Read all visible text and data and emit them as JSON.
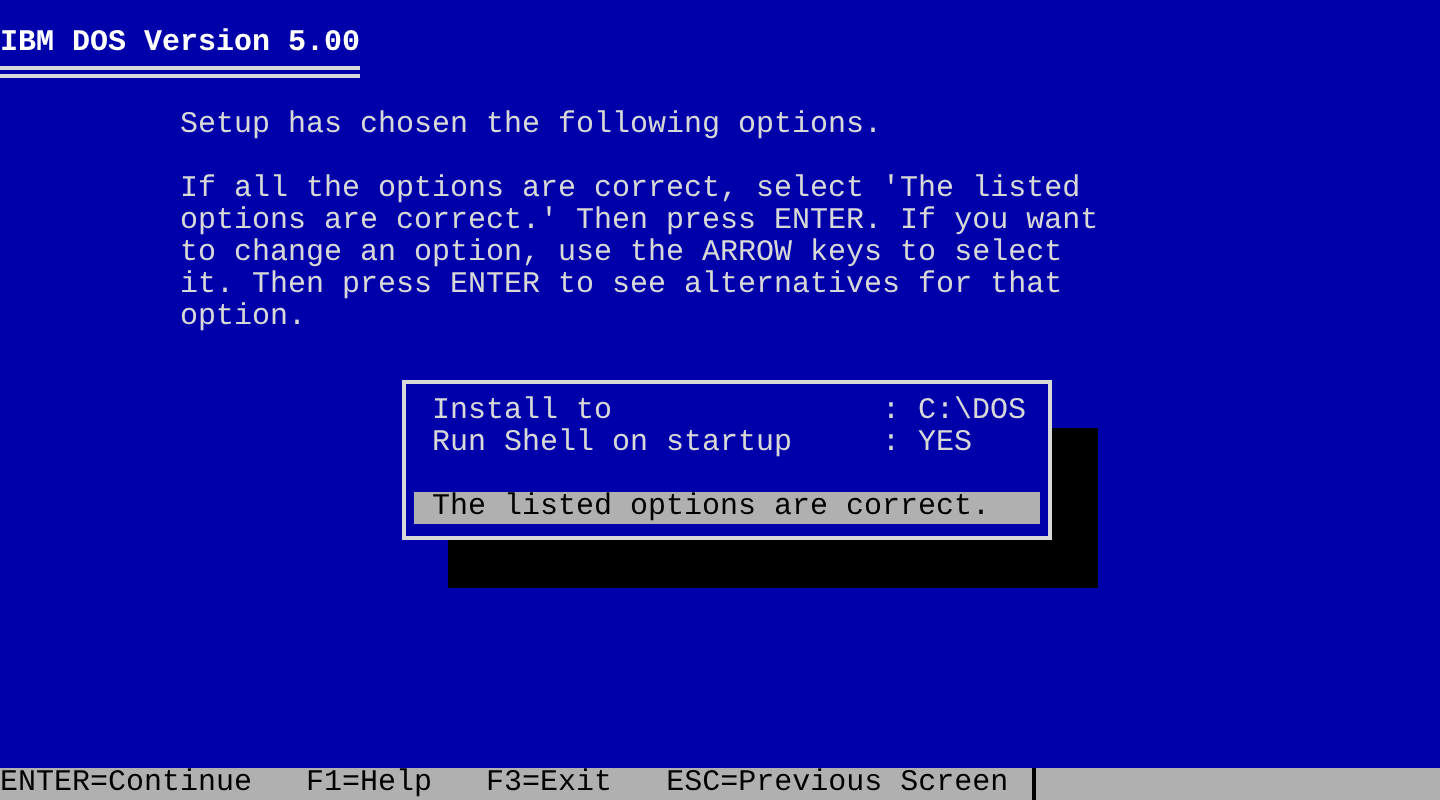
{
  "header": {
    "title": "IBM DOS Version 5.00"
  },
  "intro": "Setup has chosen the following options.",
  "instructions": "If all the options are correct, select 'The listed options are correct.' Then press ENTER. If you want to change an option, use the ARROW keys to select it. Then press ENTER to see alternatives for that option.",
  "options": [
    {
      "label": "Install to",
      "value": ": C:\\DOS",
      "selected": false
    },
    {
      "label": "Run Shell on startup",
      "value": ": YES",
      "selected": false
    }
  ],
  "confirm": {
    "label": "The listed options are correct.",
    "selected": true
  },
  "status_bar": {
    "keys": [
      "ENTER=Continue",
      "F1=Help",
      "F3=Exit",
      "ESC=Previous Screen"
    ]
  }
}
